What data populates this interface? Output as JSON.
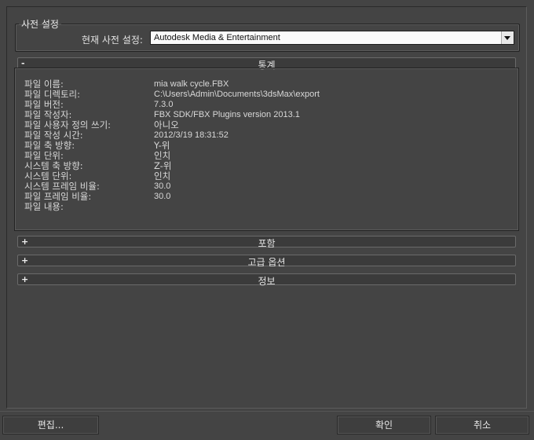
{
  "preset": {
    "legend": "사전 설정",
    "label": "현재 사전 설정:",
    "value": "Autodesk Media & Entertainment"
  },
  "stats": {
    "sign": "-",
    "title": "통계",
    "rows": [
      {
        "key": "파일 이름:",
        "value": "mia walk cycle.FBX"
      },
      {
        "key": "파일 디렉토리:",
        "value": "C:\\Users\\Admin\\Documents\\3dsMax\\export"
      },
      {
        "key": "파일 버전:",
        "value": "7.3.0"
      },
      {
        "key": "파일 작성자:",
        "value": "FBX SDK/FBX Plugins version 2013.1"
      },
      {
        "key": "파일 사용자 정의 쓰기:",
        "value": "아니오"
      },
      {
        "key": "파일 작성 시간:",
        "value": "2012/3/19  18:31:52"
      },
      {
        "key": "파일 축 방향:",
        "value": "Y-위"
      },
      {
        "key": "파일 단위:",
        "value": "인치"
      },
      {
        "key": "시스템 축 방향:",
        "value": "Z-위"
      },
      {
        "key": "시스템 단위:",
        "value": "인치"
      },
      {
        "key": "시스템 프레임 비율:",
        "value": "30.0"
      },
      {
        "key": "파일 프레임 비율:",
        "value": "30.0"
      },
      {
        "key": "파일 내용:",
        "value": ""
      }
    ]
  },
  "rollouts": [
    {
      "sign": "+",
      "title": "포함"
    },
    {
      "sign": "+",
      "title": "고급 옵션"
    },
    {
      "sign": "+",
      "title": "정보"
    }
  ],
  "buttons": {
    "edit": "편집...",
    "ok": "확인",
    "cancel": "취소"
  }
}
